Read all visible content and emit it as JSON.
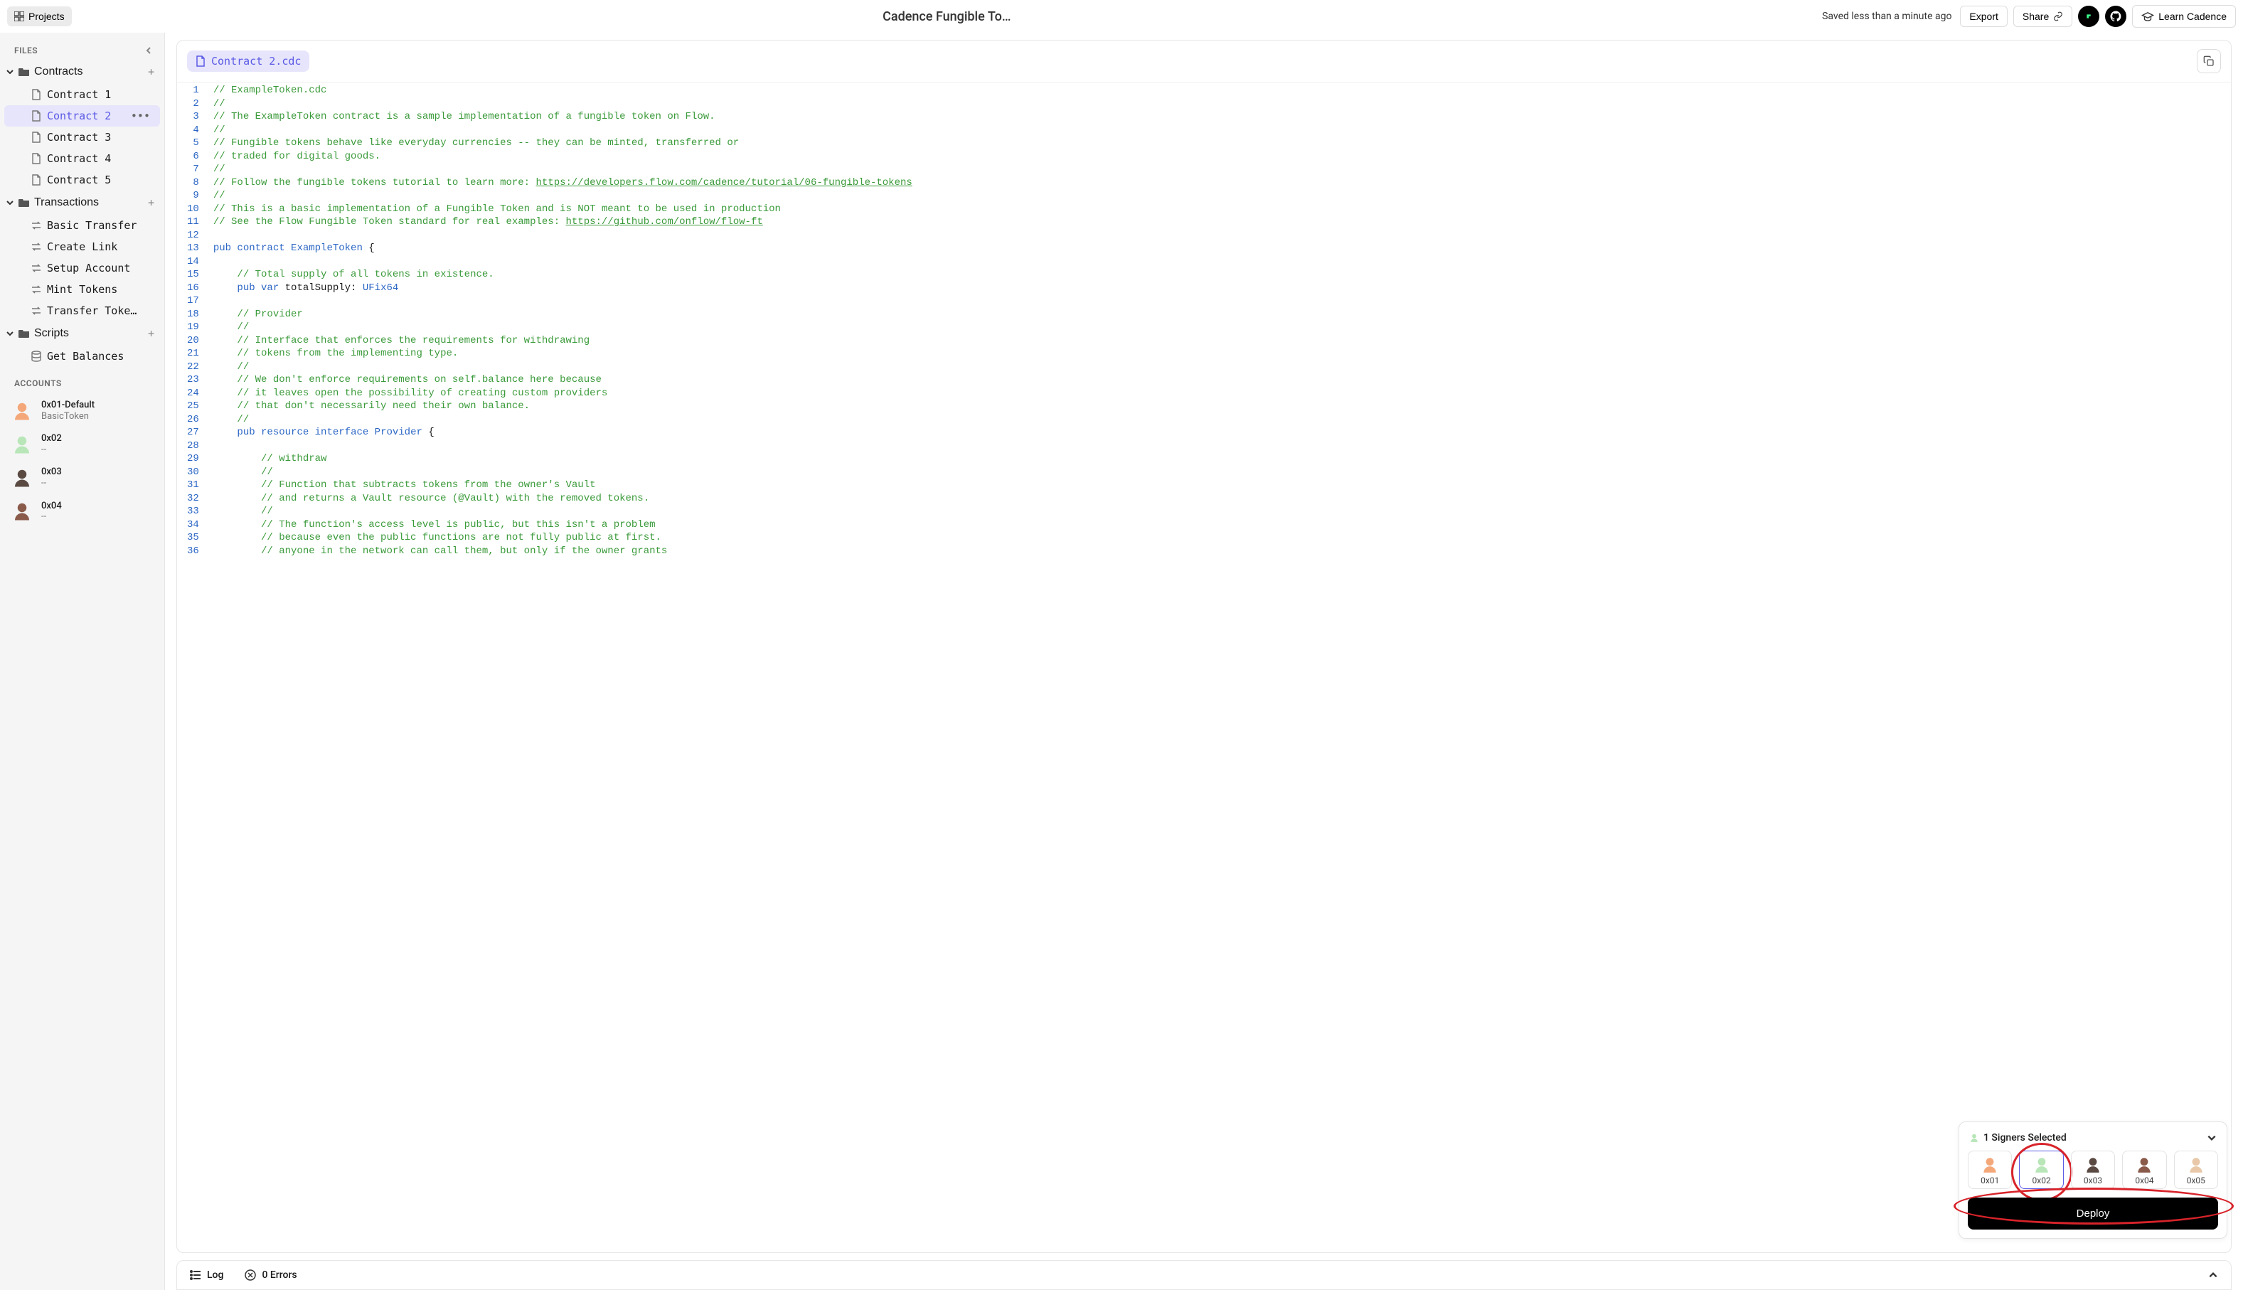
{
  "topbar": {
    "projects_label": "Projects",
    "title": "Cadence Fungible To…",
    "saved_text": "Saved less than a minute ago",
    "export_label": "Export",
    "share_label": "Share",
    "learn_label": "Learn Cadence"
  },
  "sidebar": {
    "files_label": "FILES",
    "folders": {
      "contracts": {
        "label": "Contracts",
        "items": [
          "Contract 1",
          "Contract 2",
          "Contract 3",
          "Contract 4",
          "Contract 5"
        ],
        "active_index": 1
      },
      "transactions": {
        "label": "Transactions",
        "items": [
          "Basic Transfer",
          "Create Link",
          "Setup Account",
          "Mint Tokens",
          "Transfer Toke…"
        ]
      },
      "scripts": {
        "label": "Scripts",
        "items": [
          "Get Balances"
        ]
      }
    },
    "accounts_label": "ACCOUNTS",
    "accounts": [
      {
        "addr": "0x01-Default",
        "sub": "BasicToken",
        "color": "#f4a87a"
      },
      {
        "addr": "0x02",
        "sub": "--",
        "color": "#b8e6b8"
      },
      {
        "addr": "0x03",
        "sub": "--",
        "color": "#5a4a42"
      },
      {
        "addr": "0x04",
        "sub": "--",
        "color": "#8a5a4a"
      }
    ]
  },
  "editor": {
    "tab_label": "Contract 2.cdc",
    "lines": [
      {
        "n": 1,
        "seg": [
          {
            "t": "// ExampleToken.cdc",
            "c": "c-comment"
          }
        ]
      },
      {
        "n": 2,
        "seg": [
          {
            "t": "//",
            "c": "c-comment"
          }
        ]
      },
      {
        "n": 3,
        "seg": [
          {
            "t": "// The ExampleToken contract is a sample implementation of a fungible token on Flow.",
            "c": "c-comment"
          }
        ]
      },
      {
        "n": 4,
        "seg": [
          {
            "t": "//",
            "c": "c-comment"
          }
        ]
      },
      {
        "n": 5,
        "seg": [
          {
            "t": "// Fungible tokens behave like everyday currencies -- they can be minted, transferred or",
            "c": "c-comment"
          }
        ]
      },
      {
        "n": 6,
        "seg": [
          {
            "t": "// traded for digital goods.",
            "c": "c-comment"
          }
        ]
      },
      {
        "n": 7,
        "seg": [
          {
            "t": "//",
            "c": "c-comment"
          }
        ]
      },
      {
        "n": 8,
        "seg": [
          {
            "t": "// Follow the fungible tokens tutorial to learn more: ",
            "c": "c-comment"
          },
          {
            "t": "https://developers.flow.com/cadence/tutorial/06-fungible-tokens",
            "c": "c-link"
          }
        ]
      },
      {
        "n": 9,
        "seg": [
          {
            "t": "//",
            "c": "c-comment"
          }
        ]
      },
      {
        "n": 10,
        "seg": [
          {
            "t": "// This is a basic implementation of a Fungible Token and is NOT meant to be used in production",
            "c": "c-comment"
          }
        ]
      },
      {
        "n": 11,
        "seg": [
          {
            "t": "// See the Flow Fungible Token standard for real examples: ",
            "c": "c-comment"
          },
          {
            "t": "https://github.com/onflow/flow-ft",
            "c": "c-link"
          }
        ]
      },
      {
        "n": 12,
        "seg": []
      },
      {
        "n": 13,
        "seg": [
          {
            "t": "pub ",
            "c": "c-key"
          },
          {
            "t": "contract ",
            "c": "c-key"
          },
          {
            "t": "ExampleToken",
            "c": "c-ident"
          },
          {
            "t": " {",
            "c": ""
          }
        ]
      },
      {
        "n": 14,
        "seg": []
      },
      {
        "n": 15,
        "seg": [
          {
            "t": "    // Total supply of all tokens in existence.",
            "c": "c-comment"
          }
        ]
      },
      {
        "n": 16,
        "seg": [
          {
            "t": "    ",
            "c": ""
          },
          {
            "t": "pub ",
            "c": "c-key"
          },
          {
            "t": "var ",
            "c": "c-key"
          },
          {
            "t": "totalSupply: ",
            "c": ""
          },
          {
            "t": "UFix64",
            "c": "c-type"
          }
        ]
      },
      {
        "n": 17,
        "seg": []
      },
      {
        "n": 18,
        "seg": [
          {
            "t": "    // Provider",
            "c": "c-comment"
          }
        ]
      },
      {
        "n": 19,
        "seg": [
          {
            "t": "    //",
            "c": "c-comment"
          }
        ]
      },
      {
        "n": 20,
        "seg": [
          {
            "t": "    // Interface that enforces the requirements for withdrawing",
            "c": "c-comment"
          }
        ]
      },
      {
        "n": 21,
        "seg": [
          {
            "t": "    // tokens from the implementing type.",
            "c": "c-comment"
          }
        ]
      },
      {
        "n": 22,
        "seg": [
          {
            "t": "    //",
            "c": "c-comment"
          }
        ]
      },
      {
        "n": 23,
        "seg": [
          {
            "t": "    // We don't enforce requirements on self.balance here because",
            "c": "c-comment"
          }
        ]
      },
      {
        "n": 24,
        "seg": [
          {
            "t": "    // it leaves open the possibility of creating custom providers",
            "c": "c-comment"
          }
        ]
      },
      {
        "n": 25,
        "seg": [
          {
            "t": "    // that don't necessarily need their own balance.",
            "c": "c-comment"
          }
        ]
      },
      {
        "n": 26,
        "seg": [
          {
            "t": "    //",
            "c": "c-comment"
          }
        ]
      },
      {
        "n": 27,
        "seg": [
          {
            "t": "    ",
            "c": ""
          },
          {
            "t": "pub ",
            "c": "c-key"
          },
          {
            "t": "resource ",
            "c": "c-key"
          },
          {
            "t": "interface ",
            "c": "c-key"
          },
          {
            "t": "Provider",
            "c": "c-ident"
          },
          {
            "t": " {",
            "c": ""
          }
        ]
      },
      {
        "n": 28,
        "seg": []
      },
      {
        "n": 29,
        "seg": [
          {
            "t": "        // withdraw",
            "c": "c-comment"
          }
        ]
      },
      {
        "n": 30,
        "seg": [
          {
            "t": "        //",
            "c": "c-comment"
          }
        ]
      },
      {
        "n": 31,
        "seg": [
          {
            "t": "        // Function that subtracts tokens from the owner's Vault",
            "c": "c-comment"
          }
        ]
      },
      {
        "n": 32,
        "seg": [
          {
            "t": "        // and returns a Vault resource (@Vault) with the removed tokens.",
            "c": "c-comment"
          }
        ]
      },
      {
        "n": 33,
        "seg": [
          {
            "t": "        //",
            "c": "c-comment"
          }
        ]
      },
      {
        "n": 34,
        "seg": [
          {
            "t": "        // The function's access level is public, but this isn't a problem",
            "c": "c-comment"
          }
        ]
      },
      {
        "n": 35,
        "seg": [
          {
            "t": "        // because even the public functions are not fully public at first.",
            "c": "c-comment"
          }
        ]
      },
      {
        "n": 36,
        "seg": [
          {
            "t": "        // anyone in the network can call them, but only if the owner grants",
            "c": "c-comment"
          }
        ]
      }
    ]
  },
  "signers": {
    "header": "1 Signers Selected",
    "items": [
      {
        "label": "0x01",
        "color": "#f4a87a"
      },
      {
        "label": "0x02",
        "color": "#b8e6b8"
      },
      {
        "label": "0x03",
        "color": "#5a4a42"
      },
      {
        "label": "0x04",
        "color": "#8a5a4a"
      },
      {
        "label": "0x05",
        "color": "#e8c8a8"
      }
    ],
    "selected_index": 1,
    "deploy_label": "Deploy"
  },
  "footer": {
    "log_label": "Log",
    "errors_label": "0 Errors"
  }
}
